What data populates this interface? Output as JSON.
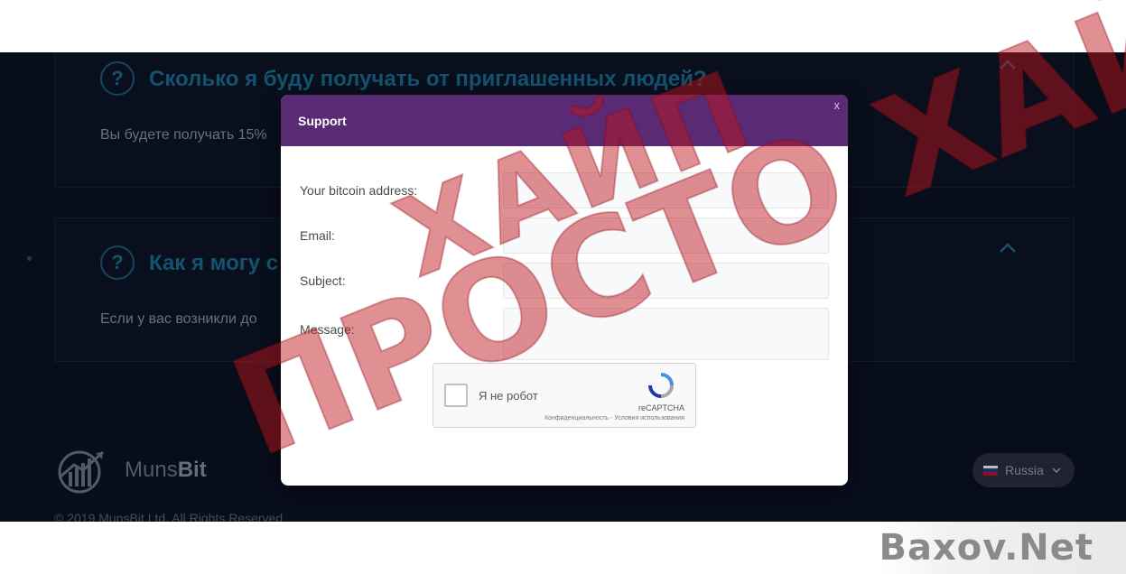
{
  "faq": [
    {
      "question": "Сколько я буду получать от приглашенных людей?",
      "answer": "Вы будете получать 15%"
    },
    {
      "question": "Как я могу с",
      "answer": "Если у вас возникли до"
    }
  ],
  "footer": {
    "logo_name": "Muns",
    "logo_suffix": "Bit",
    "copyright": "© 2019 MunsBit Ltd. All Rights Reserved",
    "language": "Russia"
  },
  "modal": {
    "title": "Support",
    "close_label": "x",
    "fields": [
      {
        "label": "Your bitcoin address:",
        "value": "",
        "placeholder": ""
      },
      {
        "label": "Email:",
        "value": "",
        "placeholder": ""
      },
      {
        "label": "Subject:",
        "value": "",
        "placeholder": ""
      },
      {
        "label": "Message:",
        "value": "",
        "placeholder": ""
      }
    ],
    "captcha": {
      "label": "Я не робот",
      "brand": "reCAPTCHA",
      "terms": "Конфиденциальность - Условия использования"
    }
  },
  "watermark": {
    "line1": "ХАЙП",
    "line2": "ПРОСТО ХАЙП",
    "site": "Baxov.Net"
  },
  "colors": {
    "modal_header": "#5a2a74",
    "site_background": "#0b1223",
    "accent": "#1a6f95",
    "stamp": "#be141e"
  },
  "icons": [
    "question-icon",
    "chevron-up-icon",
    "munsbit-logo-icon",
    "russia-flag-icon",
    "chevron-down-icon",
    "recaptcha-icon"
  ]
}
